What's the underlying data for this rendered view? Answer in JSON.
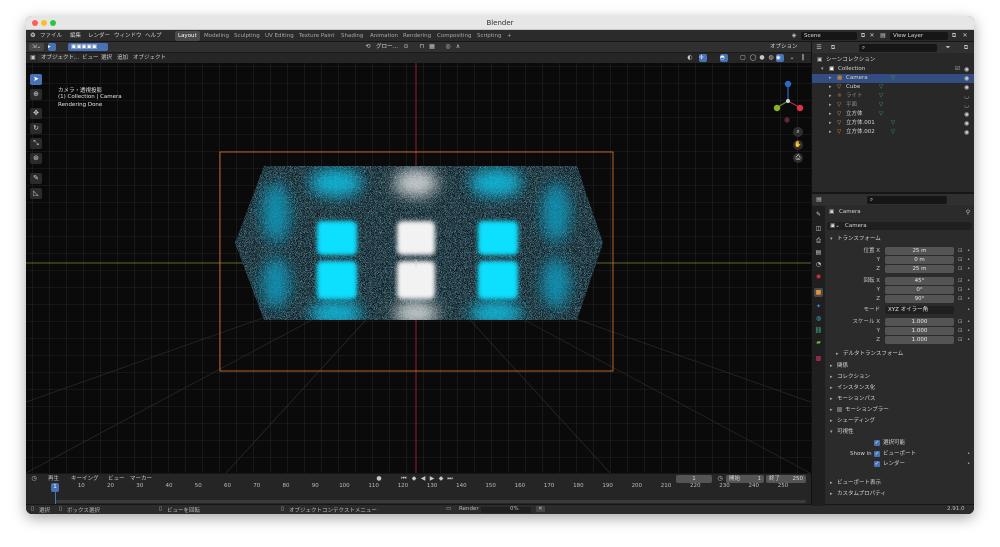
{
  "window": {
    "title": "Blender"
  },
  "topbar": {
    "menus": [
      "ファイル",
      "編集",
      "レンダー",
      "ウィンドウ",
      "ヘルプ"
    ],
    "workspaces": [
      {
        "label": "Layout",
        "active": true
      },
      {
        "label": "Modeling",
        "active": false
      },
      {
        "label": "Sculpting",
        "active": false
      },
      {
        "label": "UV Editing",
        "active": false
      },
      {
        "label": "Texture Paint",
        "active": false
      },
      {
        "label": "Shading",
        "active": false
      },
      {
        "label": "Animation",
        "active": false
      },
      {
        "label": "Rendering",
        "active": false
      },
      {
        "label": "Compositing",
        "active": false
      },
      {
        "label": "Scripting",
        "active": false
      }
    ],
    "add_workspace": "+",
    "scene": "Scene",
    "view_layer": "View Layer"
  },
  "viewport_toolbar": {
    "transform_orientation": "グロー…",
    "options": "オプション"
  },
  "viewport_header": {
    "mode": "オブジェクト…",
    "menus": [
      "ビュー",
      "選択",
      "追加",
      "オブジェクト"
    ]
  },
  "viewport": {
    "overlay_lines": [
      "カメラ・透視投影",
      "(1) Collection | Camera",
      "Rendering Done"
    ],
    "gizmo_axes": [
      "X",
      "Y",
      "Z"
    ],
    "render_colors": {
      "cyan": "#11dfff",
      "white": "#f2f2f2",
      "grid": "#3b3b3b",
      "camera_frame": "#e0762c"
    }
  },
  "timeline": {
    "menus": [
      "再生",
      "キーイング",
      "ビュー",
      "マーカー"
    ],
    "current_frame": "1",
    "start_label": "開始",
    "start": "1",
    "end_label": "終了",
    "end": "250",
    "ticks": [
      "1",
      "10",
      "20",
      "30",
      "40",
      "50",
      "60",
      "70",
      "80",
      "90",
      "100",
      "110",
      "120",
      "130",
      "140",
      "150",
      "160",
      "170",
      "180",
      "190",
      "200",
      "210",
      "220",
      "230",
      "240",
      "250"
    ]
  },
  "status_bar": {
    "select": "選択",
    "box_select": "ボックス選択",
    "rotate_view": "ビューを回転",
    "context_menu": "オブジェクトコンテクストメニュー",
    "render_label": "Render",
    "render_progress": "0%",
    "version": "2.91.0"
  },
  "outliner": {
    "root": "シーンコレクション",
    "items": [
      {
        "name": "Collection",
        "level": 1,
        "icon": "collection-icon",
        "selected": false
      },
      {
        "name": "Camera",
        "level": 2,
        "icon": "camera-icon",
        "selected": true
      },
      {
        "name": "Cube",
        "level": 2,
        "icon": "mesh-icon",
        "selected": false
      },
      {
        "name": "ライト",
        "level": 2,
        "icon": "light-icon",
        "selected": false
      },
      {
        "name": "平面",
        "level": 2,
        "icon": "mesh-icon",
        "selected": false
      },
      {
        "name": "立方体",
        "level": 2,
        "icon": "mesh-icon",
        "selected": false
      },
      {
        "name": "立方体.001",
        "level": 2,
        "icon": "mesh-icon",
        "selected": false
      },
      {
        "name": "立方体.002",
        "level": 2,
        "icon": "mesh-icon",
        "selected": false
      }
    ]
  },
  "properties": {
    "object_name_header": "Camera",
    "object_name_field": "Camera",
    "transform_section": "トランスフォーム",
    "location_label": "位置 X",
    "location": [
      "25 m",
      "0 m",
      "25 m"
    ],
    "rotation_label": "回転 X",
    "rotation": [
      "45°",
      "0°",
      "90°"
    ],
    "mode_label": "モード",
    "mode_value": "XYZ オイラー角",
    "scale_label": "スケール X",
    "scale": [
      "1.000",
      "1.000",
      "1.000"
    ],
    "axis_y": "Y",
    "axis_z": "Z",
    "delta_transform": "デルタトランスフォーム",
    "sections": [
      "関係",
      "コレクション",
      "インスタンス化",
      "モーションパス",
      "モーションブラー",
      "シェーディング",
      "可視性"
    ],
    "visibility": {
      "selectable": "選択可能",
      "show_in_label": "Show in",
      "viewport": "ビューポート",
      "render": "レンダー"
    },
    "bottom_sections": [
      "ビューポート表示",
      "カスタムプロパティ"
    ]
  }
}
